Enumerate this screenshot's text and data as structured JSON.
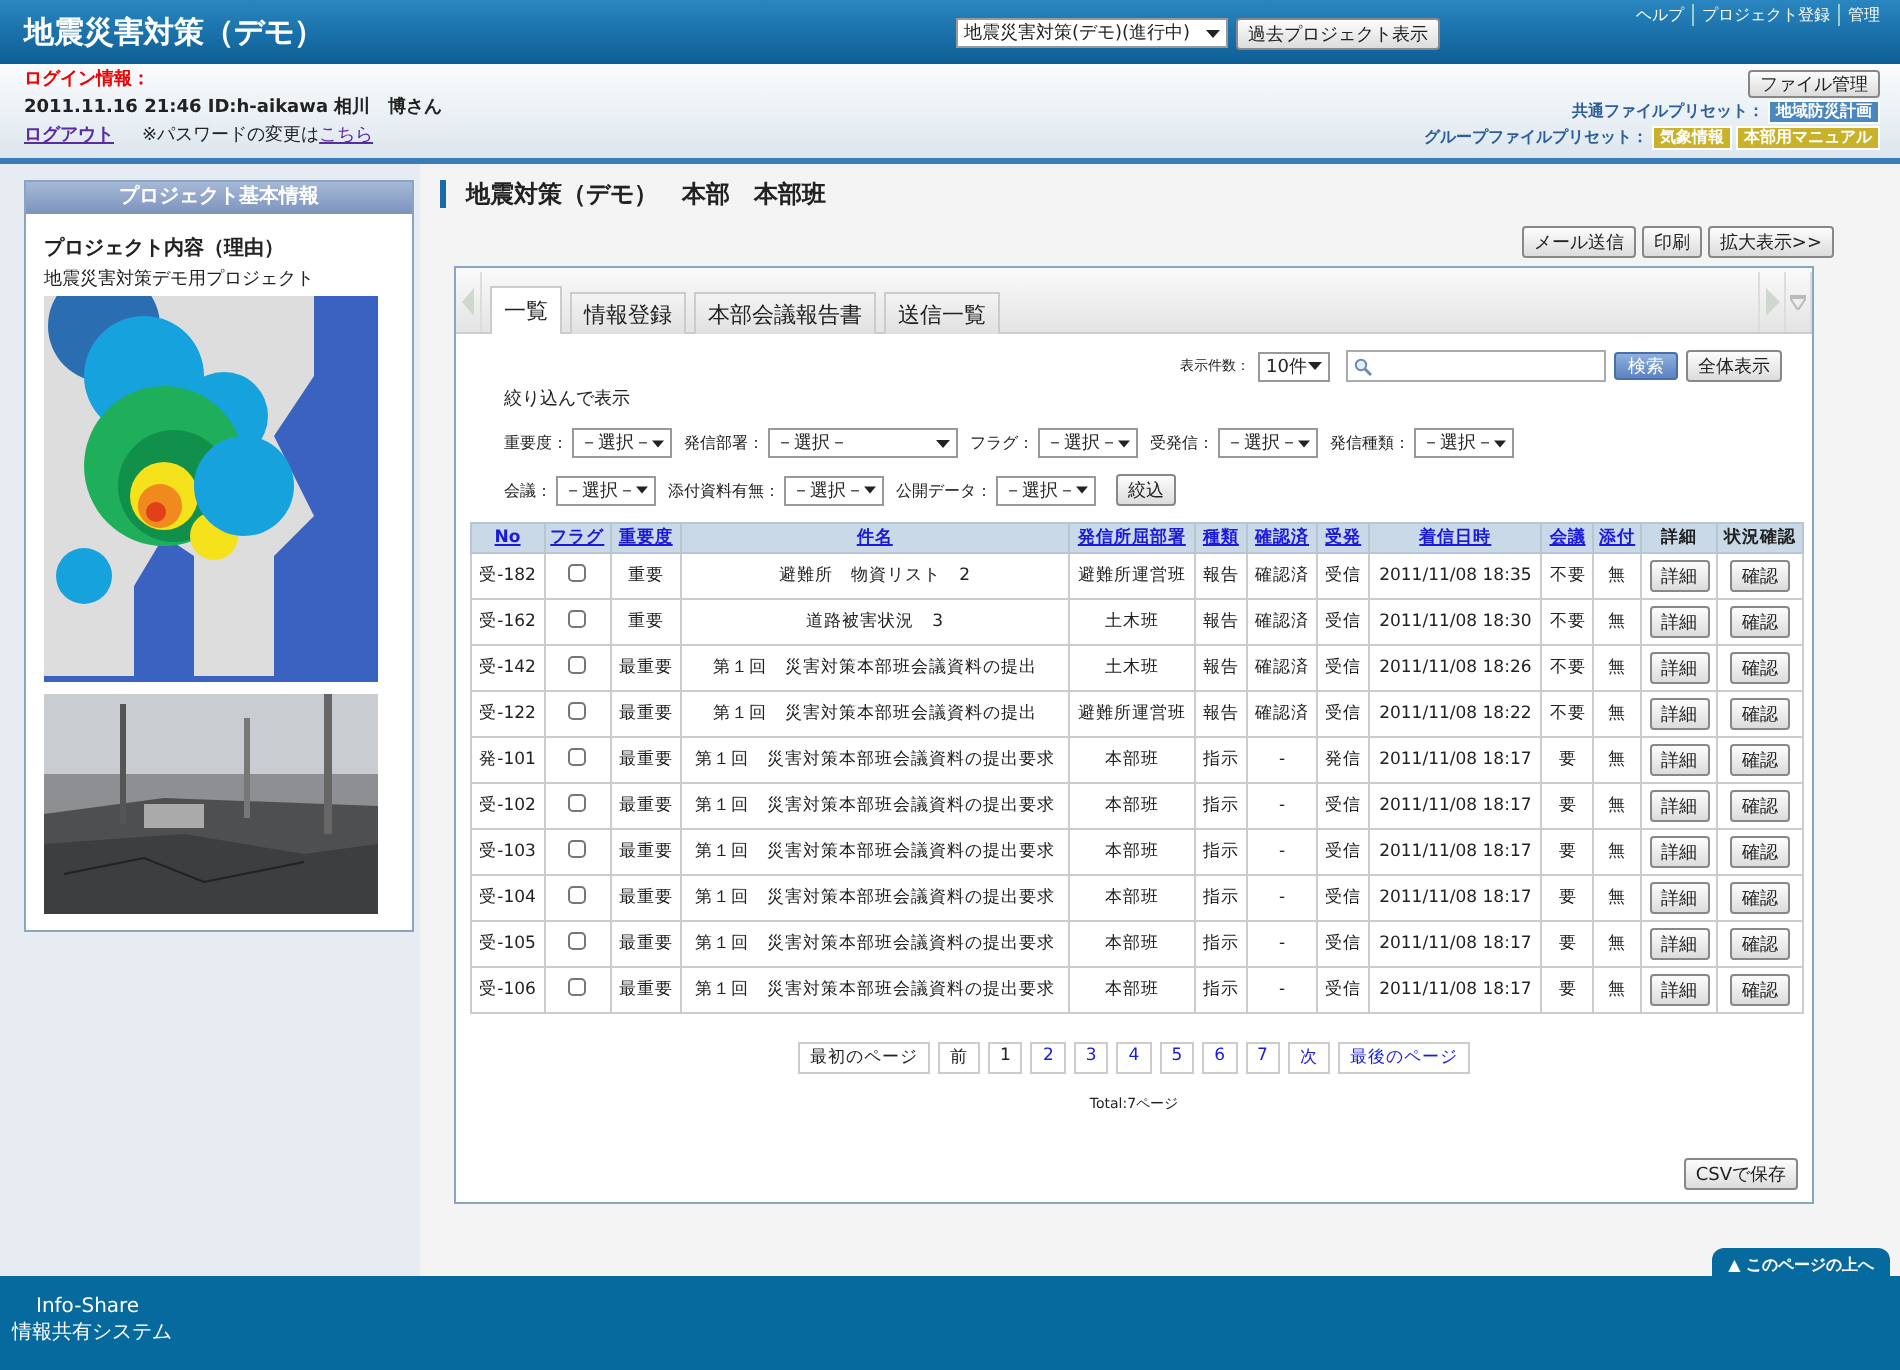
{
  "header": {
    "title": "地震災害対策（デモ）",
    "project_select": "地震災害対策(デモ)(進行中)",
    "past_button": "過去プロジェクト表示",
    "links": [
      "ヘルプ",
      "プロジェクト登録",
      "管理"
    ]
  },
  "login": {
    "label": "ログイン情報：",
    "user": "2011.11.16 21:46 ID:h-aikawa 相川　博さん",
    "logout": "ログアウト",
    "password_note": "※パスワードの変更は",
    "password_link": "こちら"
  },
  "files": {
    "button": "ファイル管理",
    "presets": [
      {
        "label": "共通ファイルプリセット：",
        "tags": [
          {
            "text": "地域防災計画",
            "color": "#4a86c0"
          }
        ]
      },
      {
        "label": "グループファイルプリセット：",
        "tags": [
          {
            "text": "気象情報",
            "color": "#c9b22a"
          },
          {
            "text": "本部用マニュアル",
            "color": "#c9b22a"
          }
        ]
      }
    ]
  },
  "sidebar": {
    "title": "プロジェクト基本情報",
    "heading": "プロジェクト内容（理由）",
    "description": "地震災害対策デモ用プロジェクト"
  },
  "page": {
    "title": "地震対策（デモ）　本部　本部班",
    "actions": [
      "メール送信",
      "印刷",
      "拡大表示>>"
    ]
  },
  "tabs": [
    {
      "label": "一覧",
      "selected": true
    },
    {
      "label": "情報登録",
      "selected": false
    },
    {
      "label": "本部会議報告書",
      "selected": false
    },
    {
      "label": "送信一覧",
      "selected": false
    }
  ],
  "search": {
    "count_label": "表示件数：",
    "count_value": "10件",
    "search_button": "検索",
    "all_button": "全体表示"
  },
  "filters": {
    "title": "絞り込んで表示",
    "rows": [
      [
        {
          "label": "重要度：",
          "value": "－選択－"
        },
        {
          "label": "発信部署：",
          "value": "－選択－",
          "wide": true
        },
        {
          "label": "フラグ：",
          "value": "－選択－"
        },
        {
          "label": "受発信：",
          "value": "－選択－"
        },
        {
          "label": "発信種類：",
          "value": "－選択－"
        }
      ],
      [
        {
          "label": "会議：",
          "value": "－選択－"
        },
        {
          "label": "添付資料有無：",
          "value": "－選択－"
        },
        {
          "label": "公開データ：",
          "value": "－選択－"
        }
      ]
    ],
    "button": "絞込"
  },
  "table": {
    "columns": [
      {
        "label": "No",
        "sortable": true
      },
      {
        "label": "フラグ",
        "sortable": true
      },
      {
        "label": "重要度",
        "sortable": true
      },
      {
        "label": "件名",
        "sortable": true
      },
      {
        "label": "発信所屈部署",
        "sortable": true
      },
      {
        "label": "種類",
        "sortable": true
      },
      {
        "label": "確認済",
        "sortable": true
      },
      {
        "label": "受発",
        "sortable": true
      },
      {
        "label": "着信日時",
        "sortable": true
      },
      {
        "label": "会議",
        "sortable": true
      },
      {
        "label": "添付",
        "sortable": true
      },
      {
        "label": "詳細",
        "sortable": false
      },
      {
        "label": "状況確認",
        "sortable": false
      }
    ],
    "rows": [
      {
        "no": "受-182",
        "flagged": false,
        "importance": "重要",
        "subject": "避難所　物資リスト　2",
        "dept": "避難所運営班",
        "type": "報告",
        "confirmed": "確認済",
        "direction": "受信",
        "received": "2011/11/08 18:35",
        "meeting": "不要",
        "attachment": "無",
        "detail": "詳細",
        "check": "確認"
      },
      {
        "no": "受-162",
        "flagged": false,
        "importance": "重要",
        "subject": "道路被害状況　3",
        "dept": "土木班",
        "type": "報告",
        "confirmed": "確認済",
        "direction": "受信",
        "received": "2011/11/08 18:30",
        "meeting": "不要",
        "attachment": "無",
        "detail": "詳細",
        "check": "確認"
      },
      {
        "no": "受-142",
        "flagged": false,
        "importance": "最重要",
        "subject": "第１回　災害対策本部班会議資料の提出",
        "dept": "土木班",
        "type": "報告",
        "confirmed": "確認済",
        "direction": "受信",
        "received": "2011/11/08 18:26",
        "meeting": "不要",
        "attachment": "無",
        "detail": "詳細",
        "check": "確認"
      },
      {
        "no": "受-122",
        "flagged": false,
        "importance": "最重要",
        "subject": "第１回　災害対策本部班会議資料の提出",
        "dept": "避難所運営班",
        "type": "報告",
        "confirmed": "確認済",
        "direction": "受信",
        "received": "2011/11/08 18:22",
        "meeting": "不要",
        "attachment": "無",
        "detail": "詳細",
        "check": "確認"
      },
      {
        "no": "発-101",
        "flagged": false,
        "importance": "最重要",
        "subject": "第１回　災害対策本部班会議資料の提出要求",
        "dept": "本部班",
        "type": "指示",
        "confirmed": "-",
        "direction": "発信",
        "received": "2011/11/08 18:17",
        "meeting": "要",
        "attachment": "無",
        "detail": "詳細",
        "check": "確認"
      },
      {
        "no": "受-102",
        "flagged": false,
        "importance": "最重要",
        "subject": "第１回　災害対策本部班会議資料の提出要求",
        "dept": "本部班",
        "type": "指示",
        "confirmed": "-",
        "direction": "受信",
        "received": "2011/11/08 18:17",
        "meeting": "要",
        "attachment": "無",
        "detail": "詳細",
        "check": "確認"
      },
      {
        "no": "受-103",
        "flagged": false,
        "importance": "最重要",
        "subject": "第１回　災害対策本部班会議資料の提出要求",
        "dept": "本部班",
        "type": "指示",
        "confirmed": "-",
        "direction": "受信",
        "received": "2011/11/08 18:17",
        "meeting": "要",
        "attachment": "無",
        "detail": "詳細",
        "check": "確認"
      },
      {
        "no": "受-104",
        "flagged": false,
        "importance": "最重要",
        "subject": "第１回　災害対策本部班会議資料の提出要求",
        "dept": "本部班",
        "type": "指示",
        "confirmed": "-",
        "direction": "受信",
        "received": "2011/11/08 18:17",
        "meeting": "要",
        "attachment": "無",
        "detail": "詳細",
        "check": "確認"
      },
      {
        "no": "受-105",
        "flagged": false,
        "importance": "最重要",
        "subject": "第１回　災害対策本部班会議資料の提出要求",
        "dept": "本部班",
        "type": "指示",
        "confirmed": "-",
        "direction": "受信",
        "received": "2011/11/08 18:17",
        "meeting": "要",
        "attachment": "無",
        "detail": "詳細",
        "check": "確認"
      },
      {
        "no": "受-106",
        "flagged": false,
        "importance": "最重要",
        "subject": "第１回　災害対策本部班会議資料の提出要求",
        "dept": "本部班",
        "type": "指示",
        "confirmed": "-",
        "direction": "受信",
        "received": "2011/11/08 18:17",
        "meeting": "要",
        "attachment": "無",
        "detail": "詳細",
        "check": "確認"
      }
    ]
  },
  "pager": {
    "items": [
      {
        "label": "最初のページ",
        "kind": "nav",
        "disabled": true
      },
      {
        "label": "前",
        "kind": "nav",
        "disabled": true
      },
      {
        "label": "1",
        "kind": "page",
        "selected": true
      },
      {
        "label": "2",
        "kind": "page",
        "selected": false
      },
      {
        "label": "3",
        "kind": "page",
        "selected": false
      },
      {
        "label": "4",
        "kind": "page",
        "selected": false
      },
      {
        "label": "5",
        "kind": "page",
        "selected": false
      },
      {
        "label": "6",
        "kind": "page",
        "selected": false
      },
      {
        "label": "7",
        "kind": "page",
        "selected": false
      },
      {
        "label": "次",
        "kind": "nav",
        "disabled": false
      },
      {
        "label": "最後のページ",
        "kind": "nav",
        "disabled": false
      }
    ],
    "total": "Total:7ページ"
  },
  "csv_button": "CSVで保存",
  "footer": {
    "brand": "Info-Share",
    "subtitle": "情報共有システム",
    "to_top": "▲ このページの上へ"
  }
}
